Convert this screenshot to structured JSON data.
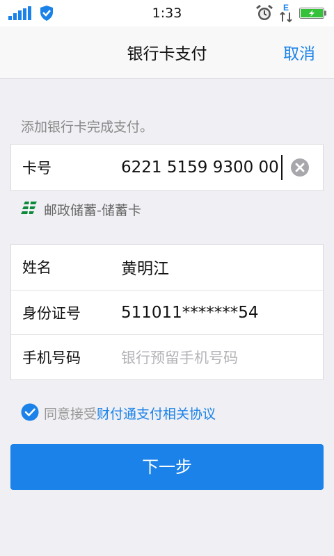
{
  "status_bar": {
    "time": "1:33",
    "icons": [
      "signal-icon",
      "security-shield-icon",
      "alarm-icon",
      "data-transfer-icon",
      "battery-charging-icon"
    ],
    "data_type": "E"
  },
  "nav": {
    "title": "银行卡支付",
    "cancel_label": "取消"
  },
  "form": {
    "hint": "添加银行卡完成支付。",
    "card": {
      "label": "卡号",
      "value": "6221 5159 9300 00",
      "clear_icon": "clear-icon"
    },
    "bank": {
      "logo_icon": "postal-bank-logo-icon",
      "name": "邮政储蓄-储蓄卡"
    },
    "fields": [
      {
        "label": "姓名",
        "value": "黄明江",
        "placeholder": ""
      },
      {
        "label": "身份证号",
        "value": "511011*******54",
        "placeholder": ""
      },
      {
        "label": "手机号码",
        "value": "",
        "placeholder": "银行预留手机号码"
      }
    ]
  },
  "agreement": {
    "checked": true,
    "prefix": "同意接受",
    "link_text": "财付通支付相关协议"
  },
  "next_button": {
    "label": "下一步"
  },
  "colors": {
    "accent": "#1a82e8",
    "background": "#efeff4",
    "bank_green": "#0f8a3d",
    "battery_green": "#35c23a"
  }
}
